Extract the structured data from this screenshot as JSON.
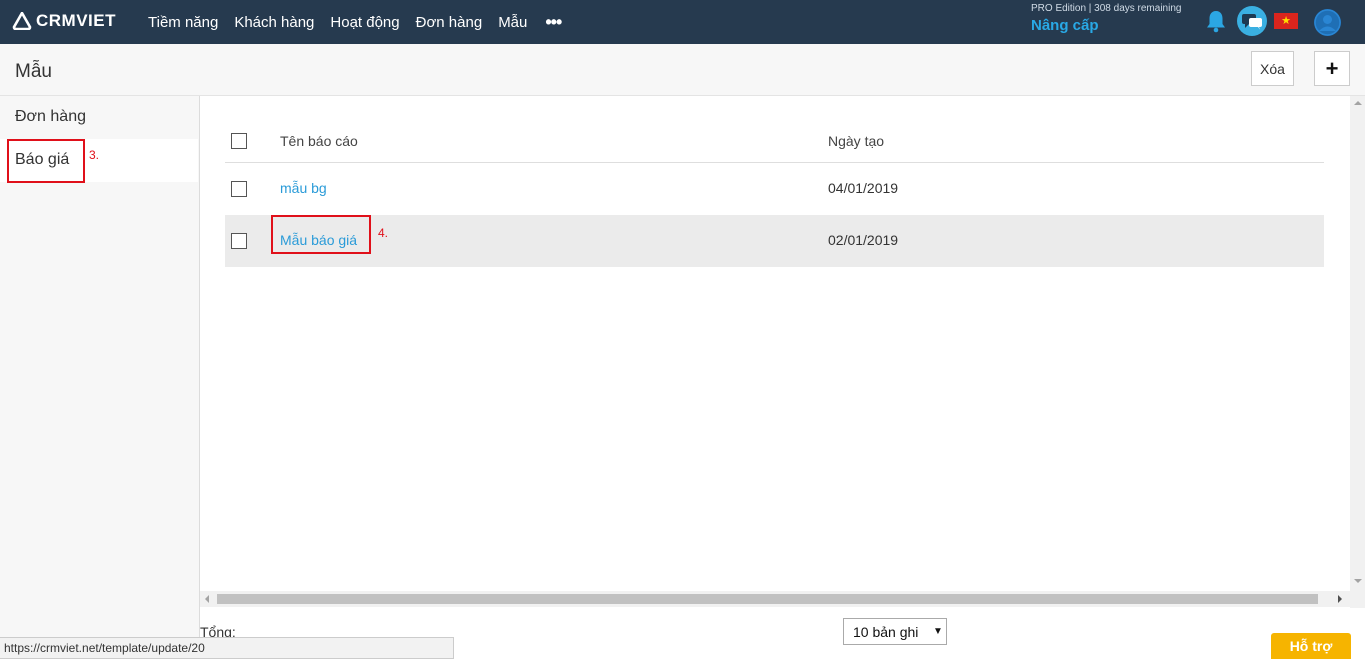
{
  "brand": {
    "name": "CRMVIET"
  },
  "nav": {
    "items": [
      "Tiềm năng",
      "Khách hàng",
      "Hoạt động",
      "Đơn hàng",
      "Mẫu"
    ],
    "more": "•••"
  },
  "account": {
    "edition": "PRO Edition | 308 days remaining",
    "upgrade": "Nâng cấp"
  },
  "icons": {
    "bell": "bell-icon",
    "chat": "chat-icon",
    "language": "vietnam-flag-icon",
    "user": "user-avatar-icon"
  },
  "colors": {
    "topbar": "#263a4f",
    "accent": "#29a9e6",
    "link": "#2a9bd8",
    "annotation": "#e0101a",
    "support": "#f6b400"
  },
  "page": {
    "title": "Mẫu",
    "delete_label": "Xóa",
    "add_label": "+"
  },
  "sidebar": {
    "items": [
      {
        "label": "Đơn hàng"
      },
      {
        "label": "Báo giá"
      }
    ],
    "annotation": "3."
  },
  "table": {
    "columns": [
      "Tên báo cáo",
      "Ngày tạo"
    ],
    "rows": [
      {
        "name": "mẫu bg",
        "date": "04/01/2019"
      },
      {
        "name": "Mẫu báo giá",
        "date": "02/01/2019"
      }
    ],
    "annotation": "4."
  },
  "footer": {
    "total_label": "Tổng:",
    "page_size": "10 bản ghi",
    "status_url": "https://crmviet.net/template/update/20",
    "support_label": "Hỗ trợ"
  }
}
